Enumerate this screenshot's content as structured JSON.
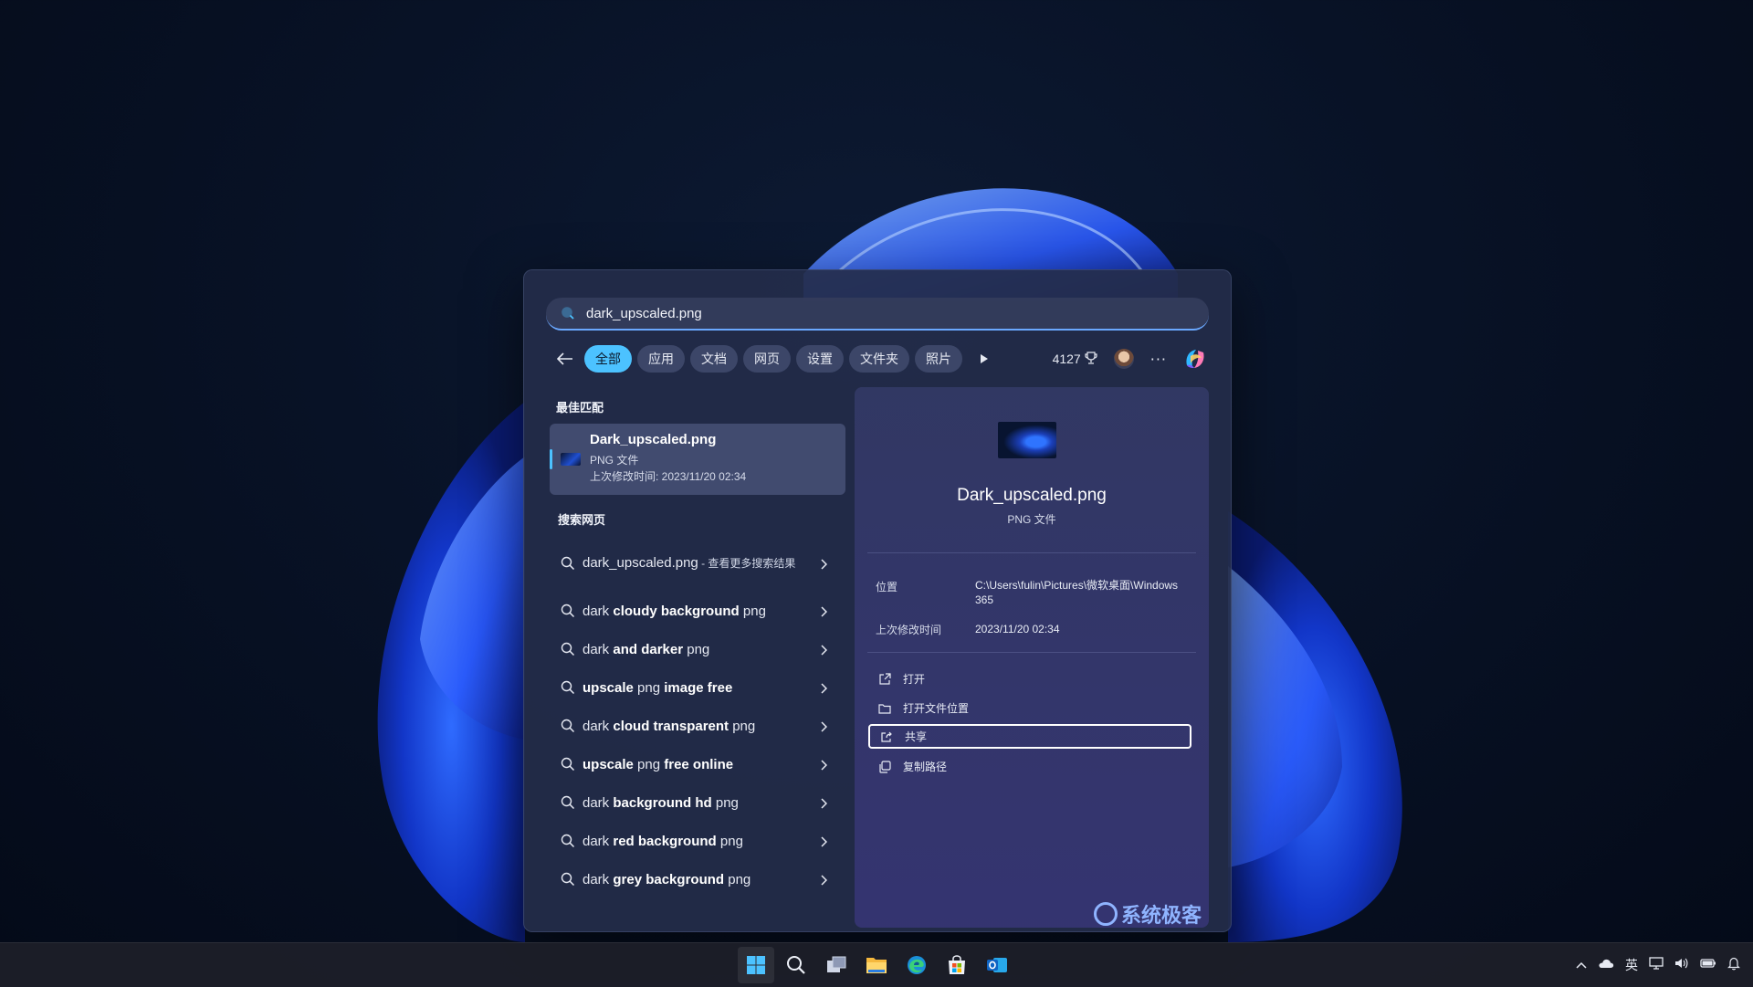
{
  "search": {
    "query": "dark_upscaled.png",
    "placeholder": ""
  },
  "filters": {
    "items": [
      "全部",
      "应用",
      "文档",
      "网页",
      "设置",
      "文件夹",
      "照片"
    ],
    "active_index": 0,
    "points": "4127"
  },
  "best_match": {
    "section_title": "最佳匹配",
    "name": "Dark_upscaled.png",
    "type": "PNG 文件",
    "modified": "上次修改时间: 2023/11/20 02:34"
  },
  "web_search": {
    "section_title": "搜索网页",
    "first": {
      "query": "dark_upscaled.png",
      "suffix": " - 查看更多搜索结果"
    },
    "items": [
      {
        "pre": "dark ",
        "bold": "cloudy background",
        "post": " png"
      },
      {
        "pre": "dark ",
        "bold": "and darker",
        "post": " png"
      },
      {
        "pre": "",
        "bold": "upscale",
        "post": " png ",
        "bold2": "image free"
      },
      {
        "pre": "dark ",
        "bold": "cloud transparent",
        "post": " png"
      },
      {
        "pre": "",
        "bold": "upscale",
        "post": " png ",
        "bold2": "free online"
      },
      {
        "pre": "dark ",
        "bold": "background hd",
        "post": " png"
      },
      {
        "pre": "dark ",
        "bold": "red background",
        "post": " png"
      },
      {
        "pre": "dark ",
        "bold": "grey background",
        "post": " png"
      }
    ]
  },
  "preview": {
    "title": "Dark_upscaled.png",
    "type": "PNG 文件",
    "location_label": "位置",
    "location_value": "C:\\Users\\fulin\\Pictures\\微软桌面\\Windows 365",
    "modified_label": "上次修改时间",
    "modified_value": "2023/11/20 02:34",
    "actions": [
      "打开",
      "打开文件位置",
      "共享",
      "复制路径"
    ],
    "focused_action_index": 2
  },
  "watermark": "系统极客",
  "taskbar": {
    "icons": [
      "start-icon",
      "search-icon",
      "task-view-icon",
      "file-explorer-icon",
      "edge-icon",
      "store-icon",
      "outlook-icon"
    ],
    "tray": {
      "ime": "英"
    }
  },
  "colors": {
    "accent": "#4cc2ff",
    "panel": "#242c4a",
    "taskbar": "#1c1e28"
  }
}
